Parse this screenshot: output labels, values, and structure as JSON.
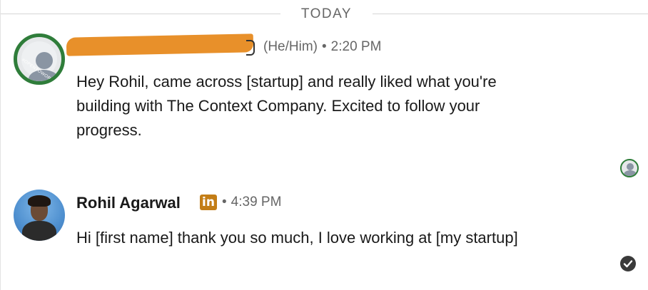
{
  "divider": {
    "label": "TODAY"
  },
  "messages": [
    {
      "sender_name": "",
      "pronouns": "(He/Him)",
      "separator": "•",
      "time": "2:20 PM",
      "body": "Hey Rohil, came across [startup] and really liked what you're building with The Context Company. Excited to follow your progress.",
      "avatar_badge_text": "#OPENTOWORK"
    },
    {
      "sender_name": "Rohil Agarwal",
      "badge": "in",
      "separator": "•",
      "time": "4:39 PM",
      "body": "Hi [first name] thank you so much, I love working at [my startup]"
    }
  ],
  "colors": {
    "redaction": "#e8902a",
    "linkedin_badge": "#c37d16",
    "open_to_work_ring": "#2f7d3a",
    "meta_text": "#666666",
    "body_text": "#191919"
  },
  "icons": {
    "read_receipt": "read-receipt-avatar-icon",
    "sent_status": "check-circle-icon"
  }
}
